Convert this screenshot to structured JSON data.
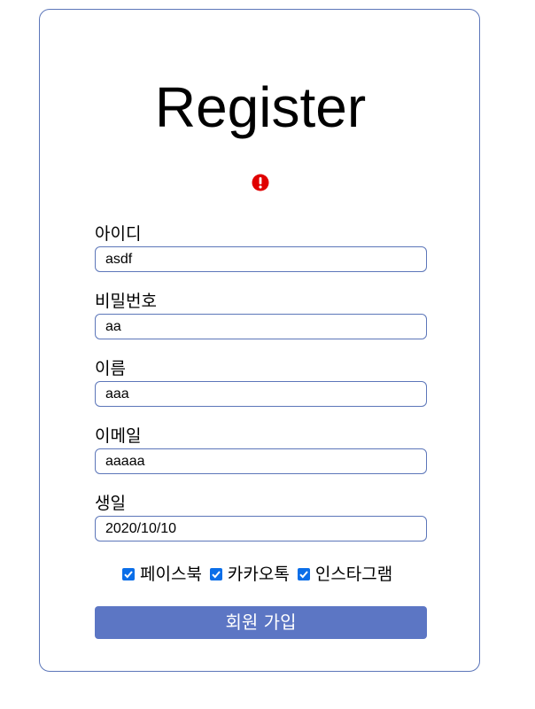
{
  "form": {
    "title": "Register",
    "fields": [
      {
        "label": "아이디",
        "value": "asdf"
      },
      {
        "label": "비밀번호",
        "value": "aa"
      },
      {
        "label": "이름",
        "value": "aaa"
      },
      {
        "label": "이메일",
        "value": "aaaaa"
      },
      {
        "label": "생일",
        "value": "2020/10/10"
      }
    ],
    "checkboxes": [
      {
        "label": "페이스북",
        "checked": true
      },
      {
        "label": "카카오톡",
        "checked": true
      },
      {
        "label": "인스타그램",
        "checked": true
      }
    ],
    "submit_label": "회원 가입"
  },
  "colors": {
    "border": "#5c76b9",
    "button": "#5c76c4",
    "checkbox": "#0b6ee8",
    "error": "#e00000"
  },
  "icons": {
    "error": "exclamation-circle"
  }
}
